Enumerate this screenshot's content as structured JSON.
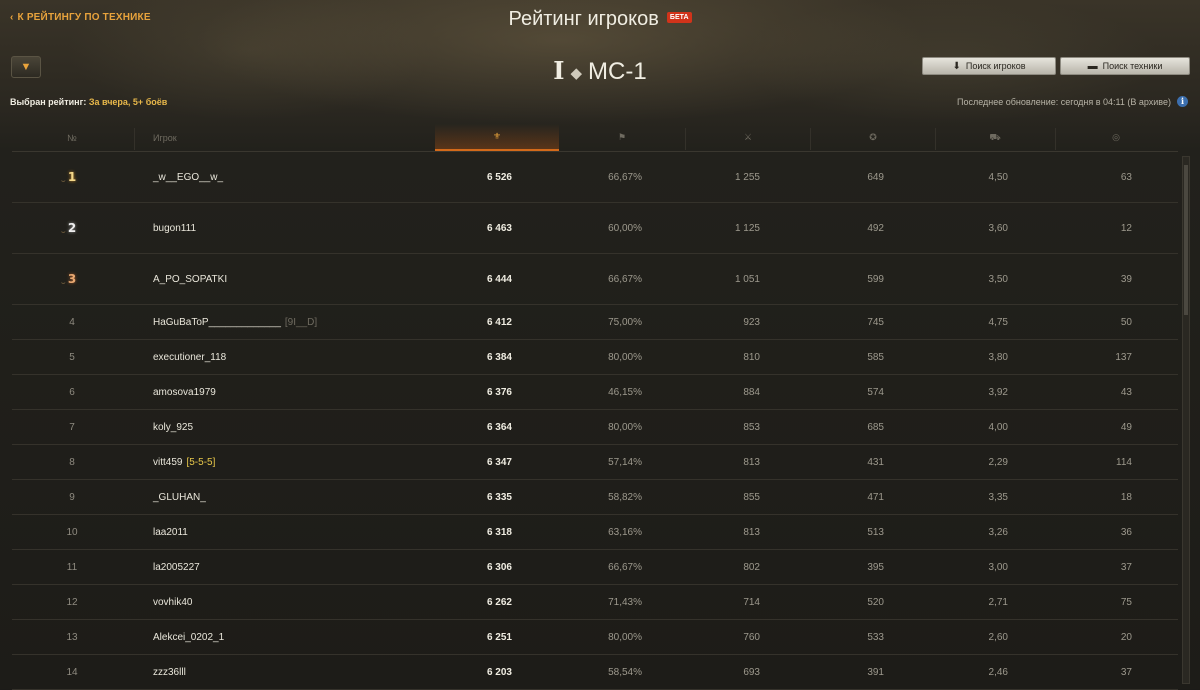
{
  "nav": {
    "back_label": "К РЕЙТИНГУ ПО ТЕХНИКЕ"
  },
  "header": {
    "title": "Рейтинг игроков",
    "beta": "БЕТА"
  },
  "vehicle": {
    "tier": "I",
    "name": "МС-1"
  },
  "buttons": {
    "search_players": "Поиск игроков",
    "search_vehicles": "Поиск техники"
  },
  "rating": {
    "label": "Выбран рейтинг:",
    "value": "За вчера, 5+ боёв"
  },
  "update": {
    "text": "Последнее обновление: сегодня в 04:11 (В архиве)"
  },
  "columns": {
    "rank": "№",
    "player": "Игрок"
  },
  "icons": {
    "filter": "filter-icon",
    "rating": "rating-laurel-icon",
    "wins": "flag-icon",
    "battles": "crossed-swords-icon",
    "xp": "star-icon",
    "damage": "tank-damage-icon",
    "spotted": "spotted-icon",
    "info": "info-icon"
  },
  "colors": {
    "accent": "#e8a33c",
    "beta_bg": "#d1331a",
    "clan_highlight": "#e8c84a"
  },
  "rows": [
    {
      "rank": "1",
      "name": "_w__EGO__w_",
      "clan": "",
      "score": "6 526",
      "winrate": "66,67%",
      "battles": "1 255",
      "xp": "649",
      "ratio": "4,50",
      "last": "63"
    },
    {
      "rank": "2",
      "name": "bugon111",
      "clan": "",
      "score": "6 463",
      "winrate": "60,00%",
      "battles": "1 125",
      "xp": "492",
      "ratio": "3,60",
      "last": "12"
    },
    {
      "rank": "3",
      "name": "A_PO_SOPATKI",
      "clan": "",
      "score": "6 444",
      "winrate": "66,67%",
      "battles": "1 051",
      "xp": "599",
      "ratio": "3,50",
      "last": "39"
    },
    {
      "rank": "4",
      "name": "HaGuBaToP_____________",
      "clan": "[9I__D]",
      "score": "6 412",
      "winrate": "75,00%",
      "battles": "923",
      "xp": "745",
      "ratio": "4,75",
      "last": "50"
    },
    {
      "rank": "5",
      "name": "executioner_118",
      "clan": "",
      "score": "6 384",
      "winrate": "80,00%",
      "battles": "810",
      "xp": "585",
      "ratio": "3,80",
      "last": "137"
    },
    {
      "rank": "6",
      "name": "amosova1979",
      "clan": "",
      "score": "6 376",
      "winrate": "46,15%",
      "battles": "884",
      "xp": "574",
      "ratio": "3,92",
      "last": "43"
    },
    {
      "rank": "7",
      "name": "koly_925",
      "clan": "",
      "score": "6 364",
      "winrate": "80,00%",
      "battles": "853",
      "xp": "685",
      "ratio": "4,00",
      "last": "49"
    },
    {
      "rank": "8",
      "name": "vitt459",
      "clan": "[5-5-5]",
      "score": "6 347",
      "winrate": "57,14%",
      "battles": "813",
      "xp": "431",
      "ratio": "2,29",
      "last": "114"
    },
    {
      "rank": "9",
      "name": "_GLUHAN_",
      "clan": "",
      "score": "6 335",
      "winrate": "58,82%",
      "battles": "855",
      "xp": "471",
      "ratio": "3,35",
      "last": "18"
    },
    {
      "rank": "10",
      "name": "laa2011",
      "clan": "",
      "score": "6 318",
      "winrate": "63,16%",
      "battles": "813",
      "xp": "513",
      "ratio": "3,26",
      "last": "36"
    },
    {
      "rank": "11",
      "name": "la2005227",
      "clan": "",
      "score": "6 306",
      "winrate": "66,67%",
      "battles": "802",
      "xp": "395",
      "ratio": "3,00",
      "last": "37"
    },
    {
      "rank": "12",
      "name": "vovhik40",
      "clan": "",
      "score": "6 262",
      "winrate": "71,43%",
      "battles": "714",
      "xp": "520",
      "ratio": "2,71",
      "last": "75"
    },
    {
      "rank": "13",
      "name": "Alekcei_0202_1",
      "clan": "",
      "score": "6 251",
      "winrate": "80,00%",
      "battles": "760",
      "xp": "533",
      "ratio": "2,60",
      "last": "20"
    },
    {
      "rank": "14",
      "name": "zzz36lll",
      "clan": "",
      "score": "6 203",
      "winrate": "58,54%",
      "battles": "693",
      "xp": "391",
      "ratio": "2,46",
      "last": "37"
    }
  ]
}
